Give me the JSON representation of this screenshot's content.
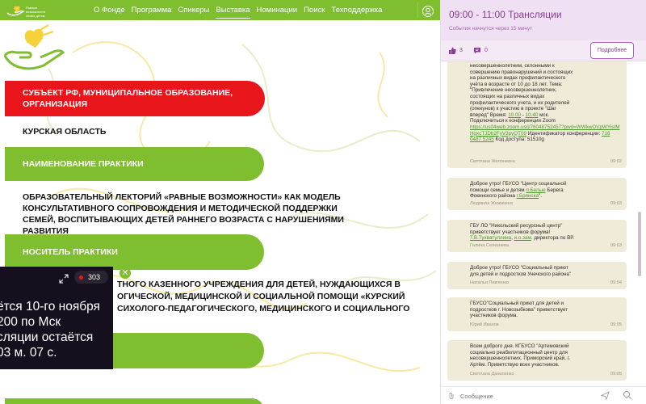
{
  "topnav": {
    "logo_text": "Равные\nвозможности\nсемья детям",
    "items": [
      "О Фонде",
      "Программа",
      "Спикеры",
      "Выставка",
      "Номинации",
      "Поиск",
      "Техподдержка"
    ],
    "active": "Выставка"
  },
  "content": {
    "subject_header": "СУБЪЕКТ РФ, МУНИЦИПАЛЬНОЕ ОБРАЗОВАНИЕ, ОРГАНИЗАЦИЯ",
    "subject_value": "КУРСКАЯ ОБЛАСТЬ",
    "practice_header": "НАИМЕНОВАНИЕ ПРАКТИКИ",
    "practice_value": "ОБРАЗОВАТЕЛЬНЫЙ ЛЕКТОРИЙ «РАВНЫЕ ВОЗМОЖНОСТИ» КАК МОДЕЛЬ КОНСУЛЬТАТИВНОГО СОПРОВОЖДЕНИЯ И МЕТОДИЧЕСКОЙ ПОДДЕРЖКИ СЕМЕЙ, ВОСПИТЫВАЮЩИХ ДЕТЕЙ РАННЕГО ВОЗРАСТА С НАРУШЕНИЯМИ РАЗВИТИЯ",
    "holder_header": "НОСИТЕЛЬ ПРАКТИКИ",
    "holder_value_lines": [
      "ТНОГО КАЗЕННОГО УЧРЕЖДЕНИЯ ДЛЯ ДЕТЕЙ, НУЖДАЮЩИХСЯ В",
      "ОГИЧЕСКОЙ, МЕДИЦИНСКОЙ И СОЦИАЛЬНОЙ ПОМОЩИ «КУРСКИЙ",
      "СИХОЛОГО-ПЕДАГОГИЧЕСКОГО, МЕДИЦИНСКОГО И СОЦИАЛЬНОГО"
    ]
  },
  "video": {
    "live_count": "303",
    "lines": [
      "ётся 10-го ноября",
      "200 по Мск",
      "сляции остаётся",
      "03 м. 07 с."
    ]
  },
  "panel": {
    "title": "09:00 - 11:00 Трансляции",
    "subtitle": "События начнутся через 15 минут",
    "likes": "3",
    "comments": "0",
    "more_label": "Подробнее",
    "messages": [
      {
        "text": "несовершеннолетним, склонными к\nсовершению правонарушений и состоящих\nна различных видах профилактического\nучёта в возрасте от 10 до 18 лет. Тема:\n\"Привлечение несовершеннолетних,\nсостоящих на различных видах\nпрофилактического учета, и их родителей\n(опекунов) к участию в проекте \"Шаг\nвперед\" Время: ",
        "time_range_a": "10.00",
        "dash": " - ",
        "time_range_b": "10.40",
        "text2": " мск.\nПодключиться к конференции Zoom\n",
        "zoom_link": "https://us04web.zoom.us/j/76048752457?pwd=WWkwOVpWYisIMHgxcTJDb2FyV3pyQT09",
        "text3": " Идентификатор конференции: ",
        "conf_id": "716 0487 5245",
        "text4": " Код доступа: 51510g",
        "author": "Светлана Желонкина",
        "time": "09:02"
      },
      {
        "text": "Доброе утро! ГБУСО \"Центр социальной\nпомощи семье и детям ",
        "link": "п.Белые",
        "text2": " Берега\nФокинского района ",
        "link2": "г.Брянска",
        "text3": "\".",
        "author": "Людмила Жижикина",
        "time": "09:03"
      },
      {
        "text": "ГБУ ЛО \"Никольский ресурсный центр\"\nприветствует участников форума!\n",
        "link": "Т.В.Тухватуллина",
        "text2": ", ",
        "link2": "и.о.зам",
        "text3": ". директора по ВР.",
        "author": "Галина Селезнева",
        "time": "09:03"
      },
      {
        "text": "Доброе утро! ГБУСО \"Социальный приют\nдля детей и подростков Унечского района\"",
        "author": "Наталья Пивченко",
        "time": "09:04"
      },
      {
        "text": "ГБУСО\"Социальный приют для детей и\nподростков г. Новозыбкова\" приветствует\nучастников форума.",
        "author": "Юрий Иванов",
        "time": "09:05"
      },
      {
        "text": "Всем доброго дня. КГБУСО \"Артемовский\nсоциально реабилитационный центр для\nнесовершеннолетних. Приморский край, г.\nАртём. Приветствую всех участников.",
        "author": "Светлана Даниленко",
        "time": "09:05"
      }
    ],
    "input_placeholder": "Сообщение"
  }
}
